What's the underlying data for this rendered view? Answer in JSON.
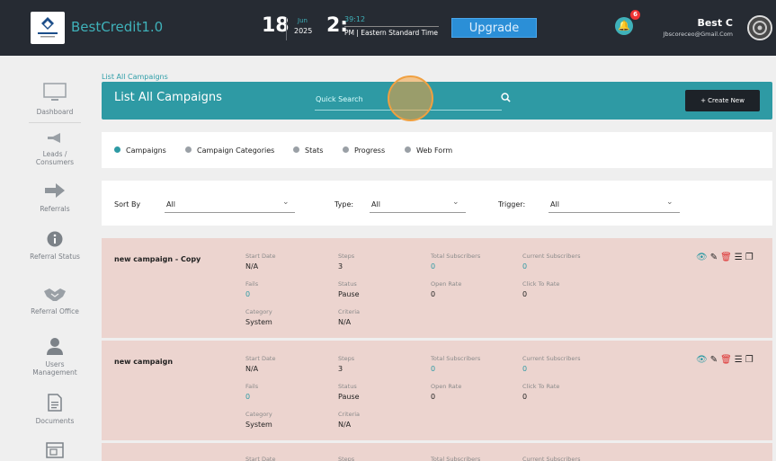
{
  "app": {
    "brand": "BestCredit1.0"
  },
  "header": {
    "day": "18",
    "month": "Jun",
    "year": "2025",
    "hour": "2:",
    "minutes": "39:12",
    "zone": "PM | Eastern Standard Time",
    "upgrade_label": "Upgrade",
    "notif_count": "6",
    "user_name": "Best C",
    "user_email": "Jbscoreceo@Gmail.Com"
  },
  "sidebar": {
    "items": [
      {
        "label": "Dashboard",
        "icon": "monitor-icon"
      },
      {
        "label": "Leads / Consumers",
        "icon": "megaphone-icon"
      },
      {
        "label": "Referrals",
        "icon": "arrow-right-icon"
      },
      {
        "label": "Referral Status",
        "icon": "info-icon"
      },
      {
        "label": "Referral Office",
        "icon": "handshake-icon"
      },
      {
        "label": "Users Management",
        "icon": "user-icon"
      },
      {
        "label": "Documents",
        "icon": "document-icon"
      },
      {
        "label": "",
        "icon": "layout-icon"
      }
    ]
  },
  "breadcrumb": "List All Campaigns",
  "title": "List All Campaigns",
  "search": {
    "placeholder": "Quick Search"
  },
  "create_label": "+ Create New",
  "tabs": [
    "Campaigns",
    "Campaign Categories",
    "Stats",
    "Progress",
    "Web Form"
  ],
  "filters": {
    "sort_label": "Sort By",
    "sort_value": "All",
    "type_label": "Type:",
    "type_value": "All",
    "trigger_label": "Trigger:",
    "trigger_value": "All"
  },
  "field_labels": {
    "start_date": "Start Date",
    "steps": "Steps",
    "total_subscribers": "Total Subscribers",
    "current_subscribers": "Current Subscribers",
    "fails": "Fails",
    "status": "Status",
    "open_rate": "Open Rate",
    "click_to_rate": "Click To Rate",
    "category": "Category",
    "criteria": "Criteria"
  },
  "campaigns": [
    {
      "name": "new campaign - Copy",
      "start_date": "N/A",
      "steps": "3",
      "total_subscribers": "0",
      "current_subscribers": "0",
      "fails": "0",
      "status": "Pause",
      "open_rate": "0",
      "click_to_rate": "0",
      "category": "System",
      "criteria": "N/A"
    },
    {
      "name": "new campaign",
      "start_date": "N/A",
      "steps": "3",
      "total_subscribers": "0",
      "current_subscribers": "0",
      "fails": "0",
      "status": "Pause",
      "open_rate": "0",
      "click_to_rate": "0",
      "category": "System",
      "criteria": "N/A"
    },
    {
      "name": "",
      "start_date": "",
      "steps": "",
      "total_subscribers": "",
      "current_subscribers": "",
      "fails": "",
      "status": "",
      "open_rate": "",
      "click_to_rate": "",
      "category": "",
      "criteria": ""
    }
  ],
  "colors": {
    "accent": "#2e9aa4",
    "header": "#262b33",
    "card": "#ecd4cf",
    "upgrade": "#2b8fd7",
    "danger": "#dd3333"
  }
}
